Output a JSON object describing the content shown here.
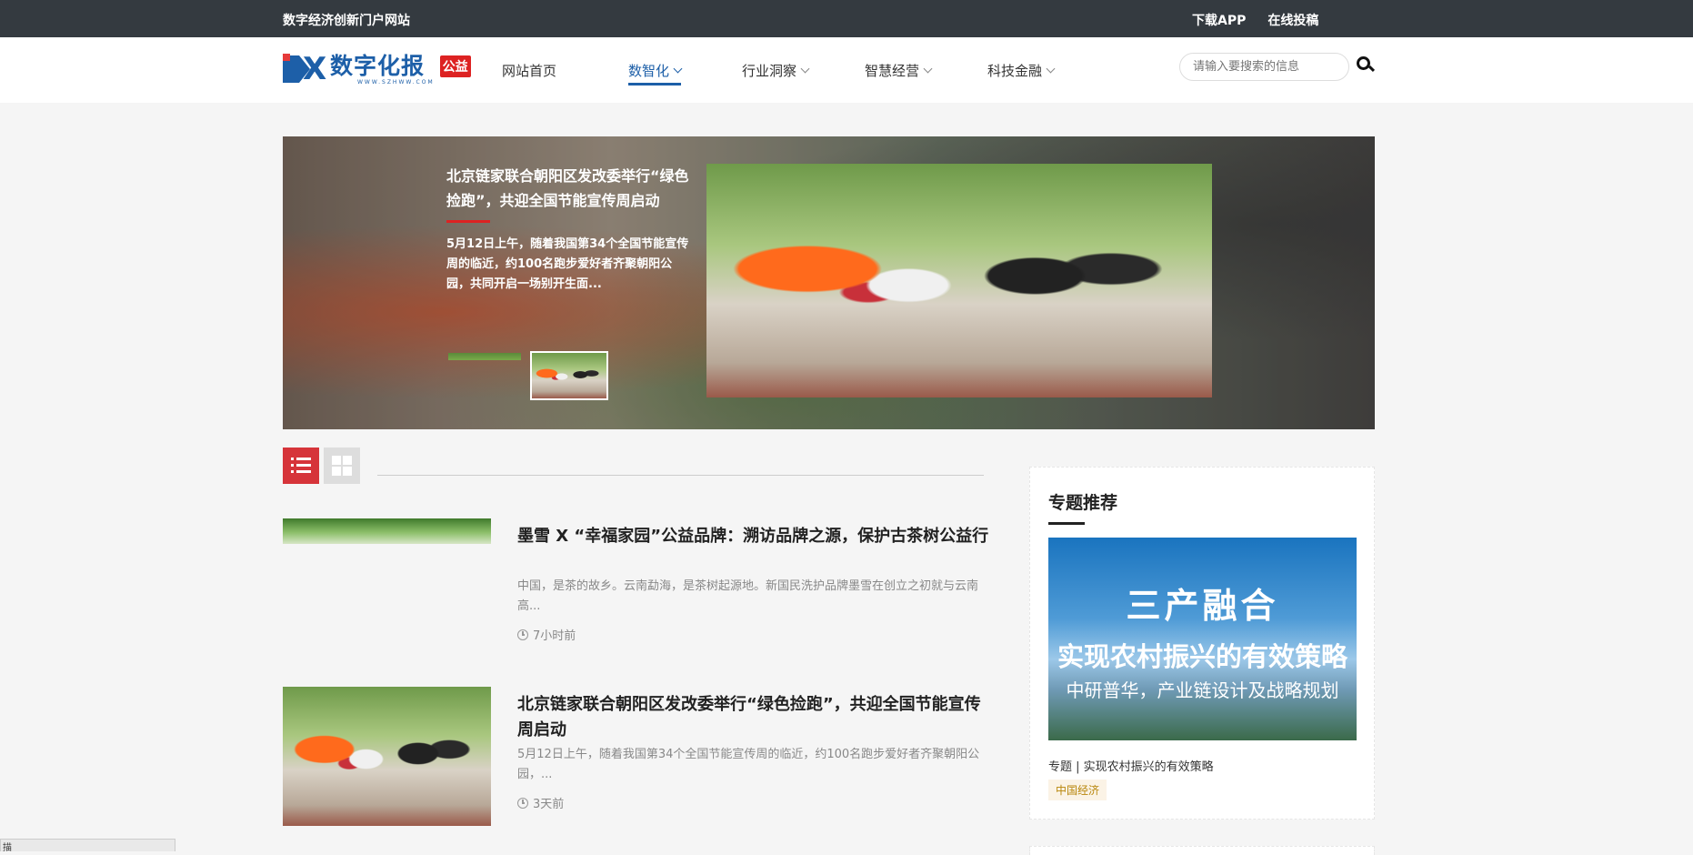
{
  "topbar": {
    "slogan": "数字经济创新门户网站",
    "links": [
      "下载APP",
      "在线投稿"
    ]
  },
  "header": {
    "logo_cn": "数字化报",
    "logo_url": "WWW.SZHWW.COM",
    "logo_badge": "公益",
    "nav": [
      {
        "label": "网站首页",
        "active": false,
        "dropdown": false
      },
      {
        "label": "数智化",
        "active": true,
        "dropdown": true
      },
      {
        "label": "行业洞察",
        "active": false,
        "dropdown": true
      },
      {
        "label": "智慧经营",
        "active": false,
        "dropdown": true
      },
      {
        "label": "科技金融",
        "active": false,
        "dropdown": true
      }
    ],
    "search_placeholder": "请输入要搜索的信息"
  },
  "hero": {
    "title": "北京链家联合朝阳区发改委举行“绿色捡跑”，共迎全国节能宣传周启动",
    "desc": "5月12日上午，随着我国第34个全国节能宣传周的临近，约100名跑步爱好者齐聚朝阳公园，共同开启一场别开生面..."
  },
  "articles": [
    {
      "title": "墨雪 X “幸福家园”公益品牌：溯访品牌之源，保护古茶树公益行",
      "summary": "中国，是茶的故乡。云南勐海，是茶树起源地。新国民洗护品牌墨雪在创立之初就与云南高...",
      "time": "7小时前"
    },
    {
      "title": "北京链家联合朝阳区发改委举行“绿色捡跑”，共迎全国节能宣传周启动",
      "summary": "5月12日上午，随着我国第34个全国节能宣传周的临近，约100名跑步爱好者齐聚朝阳公园，...",
      "time": "3天前"
    }
  ],
  "sidebar": {
    "heading": "专题推荐",
    "banner_line1": "三产融合",
    "banner_line2": "实现农村振兴的有效策略",
    "banner_line3": "中研普华，产业链设计及战略规划",
    "caption": "专题 | 实现农村振兴的有效策略",
    "tag": "中国经济"
  },
  "corner": {
    "text": "描"
  },
  "colors": {
    "topbar": "#343a40",
    "brand_blue": "#1d5fa8",
    "accent_red": "#d6343a"
  }
}
